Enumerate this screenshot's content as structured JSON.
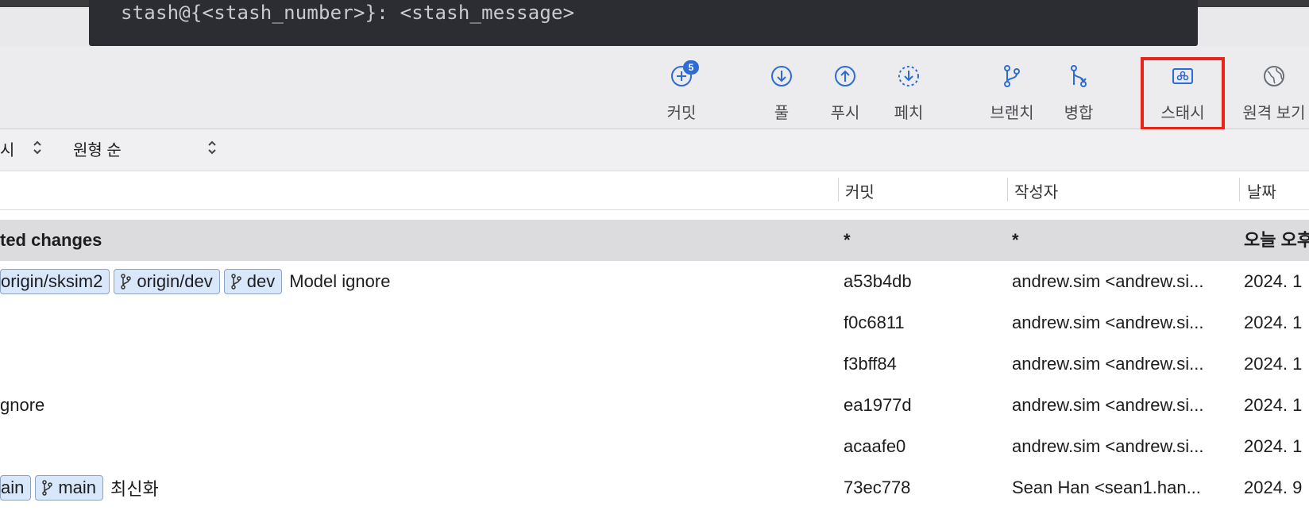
{
  "code_band": {
    "text": "stash@{<stash_number>}: <stash_message>"
  },
  "toolbar": {
    "commit": {
      "label": "커밋",
      "badge": "5",
      "icon": "plus-circle-icon"
    },
    "pull": {
      "label": "풀",
      "icon": "arrow-down-circle-icon"
    },
    "push": {
      "label": "푸시",
      "icon": "arrow-up-circle-icon"
    },
    "fetch": {
      "label": "페치",
      "icon": "dashed-arrow-down-circle-icon"
    },
    "branch": {
      "label": "브랜치",
      "icon": "branch-icon"
    },
    "merge": {
      "label": "병합",
      "icon": "merge-icon"
    },
    "stash": {
      "label": "스태시",
      "icon": "stash-box-icon"
    },
    "remote": {
      "label": "원격 보기",
      "icon": "globe-icon"
    },
    "accent_color": "#2d6cd4",
    "highlight_color": "#e8251a"
  },
  "filters": {
    "left_fragment": "시",
    "order": "원형 순"
  },
  "columns": {
    "commit": "커밋",
    "author": "작성자",
    "date": "날짜"
  },
  "rows": [
    {
      "desc": "ted changes",
      "commit": "*",
      "author": "*",
      "date": "오늘 오후"
    },
    {
      "tags": [
        "origin/sksim2",
        "origin/dev",
        "dev"
      ],
      "msg": "Model ignore",
      "commit": "a53b4db",
      "author": "andrew.sim <andrew.si...",
      "date": "2024. 1"
    },
    {
      "msg": "",
      "commit": "f0c6811",
      "author": "andrew.sim <andrew.si...",
      "date": "2024. 1"
    },
    {
      "msg": "",
      "commit": "f3bff84",
      "author": "andrew.sim <andrew.si...",
      "date": "2024. 1"
    },
    {
      "msg": "gnore",
      "commit": "ea1977d",
      "author": "andrew.sim <andrew.si...",
      "date": "2024. 1"
    },
    {
      "msg": "",
      "commit": "acaafe0",
      "author": "andrew.sim <andrew.si...",
      "date": "2024. 1"
    },
    {
      "tags": [
        "ain",
        "main"
      ],
      "msg": "최신화",
      "commit": "73ec778",
      "author": "Sean Han <sean1.han...",
      "date": "2024. 9"
    }
  ]
}
